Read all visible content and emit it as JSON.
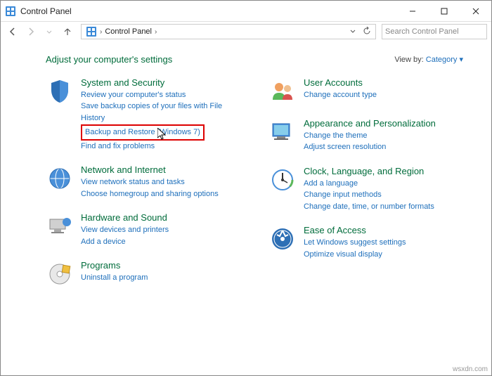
{
  "window": {
    "title": "Control Panel"
  },
  "breadcrumb": {
    "root": "Control Panel"
  },
  "search": {
    "placeholder": "Search Control Panel"
  },
  "header": {
    "title": "Adjust your computer's settings",
    "viewby_label": "View by:",
    "viewby_value": "Category"
  },
  "left": [
    {
      "title": "System and Security",
      "links": [
        "Review your computer's status",
        "Save backup copies of your files with File History",
        "Backup and Restore (Windows 7)",
        "Find and fix problems"
      ],
      "highlight_index": 2
    },
    {
      "title": "Network and Internet",
      "links": [
        "View network status and tasks",
        "Choose homegroup and sharing options"
      ]
    },
    {
      "title": "Hardware and Sound",
      "links": [
        "View devices and printers",
        "Add a device"
      ]
    },
    {
      "title": "Programs",
      "links": [
        "Uninstall a program"
      ]
    }
  ],
  "right": [
    {
      "title": "User Accounts",
      "links": [
        "Change account type"
      ]
    },
    {
      "title": "Appearance and Personalization",
      "links": [
        "Change the theme",
        "Adjust screen resolution"
      ]
    },
    {
      "title": "Clock, Language, and Region",
      "links": [
        "Add a language",
        "Change input methods",
        "Change date, time, or number formats"
      ]
    },
    {
      "title": "Ease of Access",
      "links": [
        "Let Windows suggest settings",
        "Optimize visual display"
      ]
    }
  ],
  "watermark": "wsxdn.com"
}
